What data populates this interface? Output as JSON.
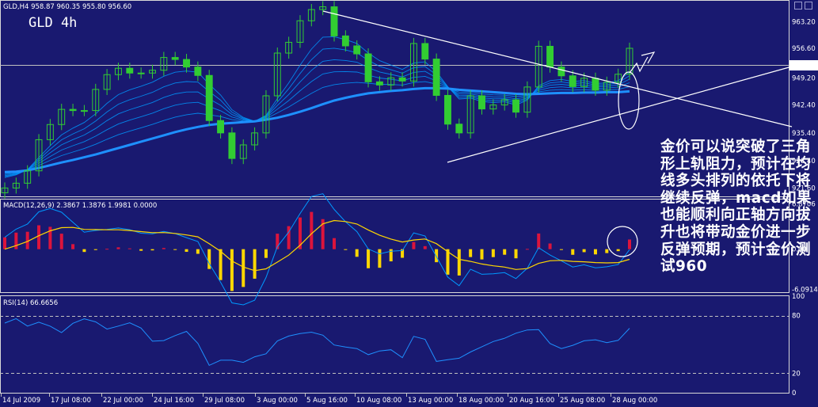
{
  "header": {
    "info": "GLD,H4  958.87 960.35 955.80 956.60",
    "chart_label": "GLD 4h"
  },
  "colors": {
    "background": "#191970",
    "candle_up": "#32cd32",
    "candle_down": "#32cd32",
    "ma": "#0099ff",
    "ma_thick": "#1e90ff",
    "hist_pos": "#dc143c",
    "hist_neg": "#ffd700",
    "signal": "#ffd700",
    "rsi": "#1e90ff",
    "text": "#ffffff",
    "trendline": "#ffffff"
  },
  "annotation": {
    "text": "金价可以说突破了三角形上轨阻力，预计在均线多头排列的依托下将继续反弹，macd如果也能顺利向正轴方向拔升也将带动金价进一步反弹预期，预计金价测试960"
  },
  "chart_data": [
    {
      "type": "candlestick",
      "title": "GLD,H4  958.87 960.35 955.80 956.60",
      "symbol": "GLD",
      "timeframe": "H4",
      "last_ohlc": {
        "open": 958.87,
        "high": 960.35,
        "low": 955.8,
        "close": 956.6
      },
      "current_price": 956.6,
      "y_ticks": [
        "963.20",
        "949.20",
        "942.40",
        "935.40",
        "928.40",
        "921.60"
      ],
      "ylim": [
        919.5,
        968.5
      ],
      "x": [
        "14 Jul 2009",
        "17 Jul 08:00",
        "22 Jul 00:00",
        "24 Jul 16:00",
        "29 Jul 08:00",
        "3 Aug 00:00",
        "5 Aug 16:00",
        "10 Aug 08:00",
        "13 Aug 00:00",
        "18 Aug 00:00",
        "20 Aug 16:00",
        "25 Aug 08:00",
        "28 Aug 00:00"
      ],
      "close": [
        921.6,
        922.8,
        925.9,
        933.7,
        937.5,
        941.3,
        941.0,
        941.0,
        946.3,
        950.0,
        951.6,
        950.4,
        950.4,
        951.1,
        954.3,
        953.8,
        951.9,
        949.8,
        938.5,
        935.4,
        929.0,
        932.4,
        935.4,
        944.7,
        955.4,
        958.1,
        963.5,
        966.3,
        967.0,
        959.7,
        957.2,
        955.2,
        948.2,
        947.4,
        949.2,
        948.4,
        957.8,
        953.9,
        944.8,
        937.6,
        935.4,
        944.7,
        941.4,
        942.4,
        943.7,
        940.6,
        946.9,
        957.1,
        951.9,
        949.7,
        947.0,
        949.1,
        946.1,
        948.1,
        950.1,
        956.6
      ],
      "ma_fast": [
        924.2,
        924.9,
        926.2,
        929.2,
        932.2,
        934.9,
        936.6,
        938.0,
        940.2,
        942.8,
        945.0,
        946.2,
        947.1,
        948.1,
        949.6,
        950.6,
        950.9,
        950.6,
        947.6,
        944.9,
        941.2,
        939.3,
        938.3,
        939.8,
        944.0,
        947.9,
        952.4,
        956.4,
        959.4,
        959.5,
        958.8,
        957.8,
        955.4,
        953.5,
        952.4,
        951.3,
        952.9,
        953.2,
        950.7,
        947.0,
        943.9,
        944.1,
        943.3,
        943.0,
        943.2,
        942.4,
        943.6,
        947.2,
        948.5,
        948.8,
        948.3,
        948.5,
        947.8,
        947.9,
        948.5,
        950.6
      ],
      "ma_slow": [
        925.6,
        925.7,
        926.0,
        926.6,
        927.3,
        928.0,
        928.6,
        929.3,
        930.0,
        930.8,
        931.6,
        932.4,
        933.2,
        934.0,
        934.8,
        935.6,
        936.3,
        936.9,
        937.4,
        937.7,
        937.9,
        938.1,
        938.3,
        938.7,
        939.2,
        939.9,
        940.7,
        941.6,
        942.6,
        943.5,
        944.2,
        944.8,
        945.3,
        945.6,
        945.9,
        946.1,
        946.4,
        946.6,
        946.6,
        946.5,
        946.2,
        946.0,
        945.8,
        945.6,
        945.4,
        945.2,
        945.1,
        945.2,
        945.3,
        945.4,
        945.4,
        945.5,
        945.5,
        945.6,
        945.6,
        945.8
      ]
    },
    {
      "type": "bar",
      "title": "MACD(12,26,9) 2.3867 1.3876 1.9981 0.0000",
      "y_ticks": [
        "6.8706",
        "0.00",
        "-6.0914"
      ],
      "ylim": [
        -6.5,
        7.5
      ],
      "histogram": [
        1.79,
        2.5,
        2.63,
        3.61,
        3.38,
        2.34,
        0.76,
        -0.42,
        -0.13,
        0.06,
        0.28,
        0.12,
        -0.24,
        -0.18,
        0.18,
        -0.02,
        -0.4,
        -0.7,
        -2.99,
        -4.67,
        -6.32,
        -5.71,
        -4.46,
        -1.32,
        2.34,
        3.48,
        4.79,
        5.63,
        4.54,
        1.67,
        -0.03,
        -1.15,
        -2.88,
        -2.81,
        -1.84,
        -1.3,
        1.08,
        0.46,
        -1.97,
        -3.85,
        -3.98,
        -1.19,
        -1.55,
        -1.2,
        -0.84,
        -1.38,
        0.04,
        2.37,
        0.86,
        -0.07,
        -0.85,
        -0.45,
        -0.79,
        -0.59,
        -0.3,
        1.46
      ],
      "signal": [
        0.0,
        0.53,
        1.17,
        2.03,
        2.77,
        3.25,
        3.29,
        2.99,
        2.96,
        2.93,
        2.93,
        2.82,
        2.65,
        2.5,
        2.51,
        2.38,
        2.15,
        1.86,
        0.83,
        -0.33,
        -1.79,
        -2.7,
        -3.25,
        -2.97,
        -1.95,
        -0.9,
        0.6,
        2.33,
        3.83,
        4.33,
        4.17,
        3.8,
        2.91,
        2.1,
        1.53,
        1.09,
        1.38,
        1.54,
        0.84,
        -0.38,
        -1.54,
        -1.84,
        -2.24,
        -2.52,
        -2.71,
        -3.06,
        -2.93,
        -2.15,
        -1.75,
        -1.69,
        -1.85,
        -1.91,
        -2.02,
        -2.07,
        -2.02,
        -1.53
      ]
    },
    {
      "type": "line",
      "title": "RSI(14) 66.6656",
      "y_ticks": [
        "100",
        "80",
        "20",
        "0"
      ],
      "ylim": [
        0,
        100
      ],
      "values": [
        72.1,
        76.7,
        69.0,
        73.0,
        68.9,
        62.3,
        71.9,
        76.5,
        73.4,
        65.9,
        69.0,
        72.4,
        67.0,
        53.4,
        54.0,
        59.2,
        63.5,
        51.1,
        28.4,
        33.7,
        33.7,
        31.5,
        37.2,
        40.3,
        53.6,
        58.7,
        61.2,
        62.7,
        59.6,
        49.4,
        47.4,
        45.7,
        39.4,
        43.3,
        44.5,
        36.3,
        58.4,
        55.3,
        32.5,
        34.3,
        35.7,
        42.2,
        47.6,
        53.0,
        56.4,
        61.6,
        65.0,
        65.3,
        51.0,
        45.7,
        49.1,
        53.8,
        54.8,
        51.9,
        54.3,
        66.7
      ]
    }
  ]
}
